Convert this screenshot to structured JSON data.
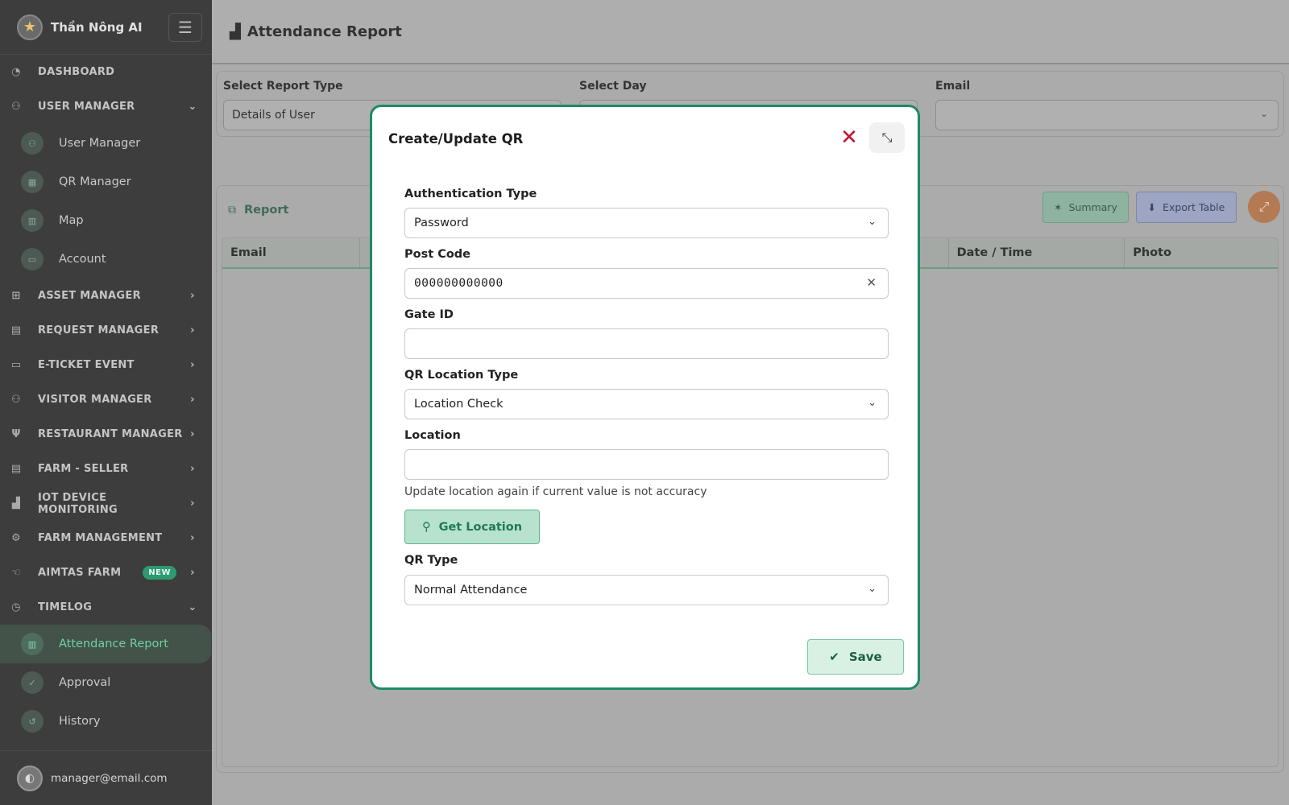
{
  "app": {
    "name": "Thần Nông AI"
  },
  "sidebar": {
    "items": [
      {
        "label": "DASHBOARD"
      },
      {
        "label": "USER MANAGER"
      },
      {
        "label": "ASSET MANAGER"
      },
      {
        "label": "REQUEST MANAGER"
      },
      {
        "label": "E-TICKET EVENT"
      },
      {
        "label": "VISITOR MANAGER"
      },
      {
        "label": "RESTAURANT MANAGER"
      },
      {
        "label": "FARM - SELLER"
      },
      {
        "label": "IOT DEVICE MONITORING"
      },
      {
        "label": "FARM MANAGEMENT"
      },
      {
        "label": "AIMTAS FARM",
        "badge": "NEW"
      },
      {
        "label": "TIMELOG"
      }
    ],
    "user_manager_sub": [
      {
        "label": "User Manager"
      },
      {
        "label": "QR Manager"
      },
      {
        "label": "Map"
      },
      {
        "label": "Account"
      }
    ],
    "timelog_sub": [
      {
        "label": "Attendance Report"
      },
      {
        "label": "Approval"
      },
      {
        "label": "History"
      }
    ],
    "footer_email": "manager@email.com"
  },
  "header": {
    "title": "Attendance Report"
  },
  "filters": {
    "report_type_label": "Select Report Type",
    "report_type_value": "Details of User",
    "day_label": "Select Day",
    "email_label": "Email"
  },
  "report": {
    "title": "Report",
    "summary_label": "Summary",
    "export_label": "Export Table",
    "columns": [
      "Email",
      "Date / Time",
      "Photo"
    ]
  },
  "modal": {
    "title": "Create/Update QR",
    "auth_type_label": "Authentication Type",
    "auth_type_value": "Password",
    "post_code_label": "Post Code",
    "post_code_value": "000000000000",
    "gate_id_label": "Gate ID",
    "gate_id_value": "",
    "qr_location_type_label": "QR Location Type",
    "qr_location_type_value": "Location Check",
    "location_label": "Location",
    "location_value": "",
    "location_hint": "Update location again if current value is not accuracy",
    "get_location_label": "Get Location",
    "qr_type_label": "QR Type",
    "qr_type_value": "Normal Attendance",
    "save_label": "Save"
  },
  "colors": {
    "accent": "#1f8a66",
    "close": "#c4122c",
    "sidebar_bg": "#3d3d3d"
  }
}
